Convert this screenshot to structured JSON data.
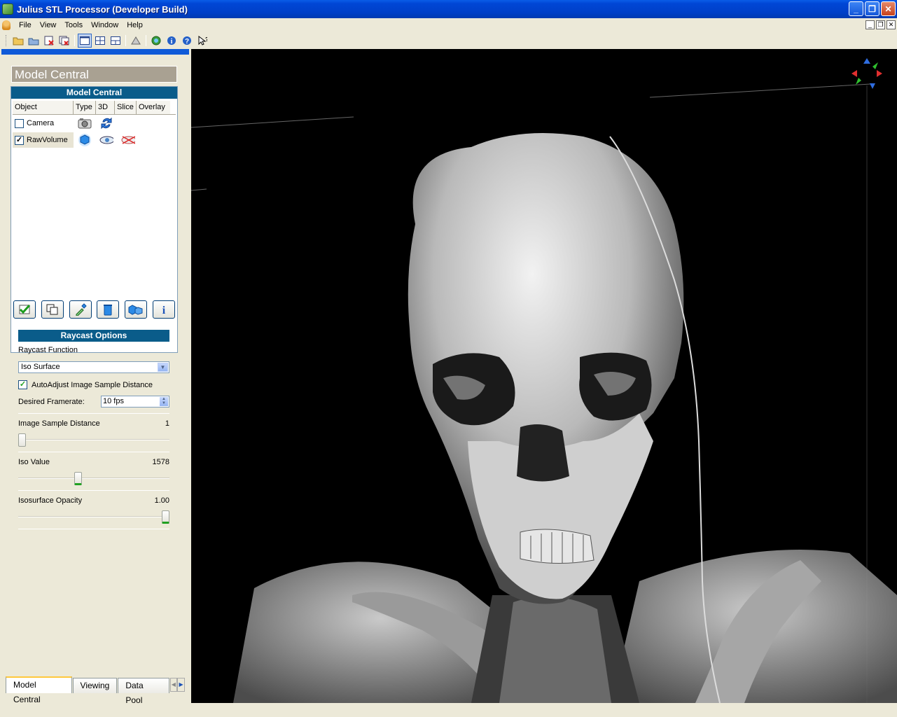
{
  "window": {
    "title": "Julius STL Processor (Developer Build)"
  },
  "menu": {
    "items": [
      "File",
      "View",
      "Tools",
      "Window",
      "Help"
    ]
  },
  "left_panel": {
    "header": "Model Central",
    "section_title": "Model Central",
    "columns": [
      "Object",
      "Type",
      "3D",
      "Slice",
      "Overlay"
    ],
    "objects": [
      {
        "name": "Camera",
        "checked": false
      },
      {
        "name": "RawVolume",
        "checked": true
      }
    ]
  },
  "raycast": {
    "title": "Raycast Options",
    "function_label": "Raycast Function",
    "function_value": "Iso Surface",
    "autoadjust_label": "AutoAdjust Image Sample Distance",
    "autoadjust_checked": true,
    "framerate_label": "Desired Framerate:",
    "framerate_value": "10 fps",
    "sample_distance_label": "Image Sample Distance",
    "sample_distance_value": "1",
    "sample_distance_fraction": 0.0,
    "iso_label": "Iso Value",
    "iso_value": "1578",
    "iso_fraction": 0.39,
    "opacity_label": "Isosurface Opacity",
    "opacity_value": "1.00",
    "opacity_fraction": 1.0
  },
  "tabs": [
    "Model Central",
    "Viewing",
    "Data Pool"
  ],
  "colors": {
    "title_bar": "#0046d5",
    "section": "#0a5c8a",
    "accent": "#0f5ad8"
  }
}
